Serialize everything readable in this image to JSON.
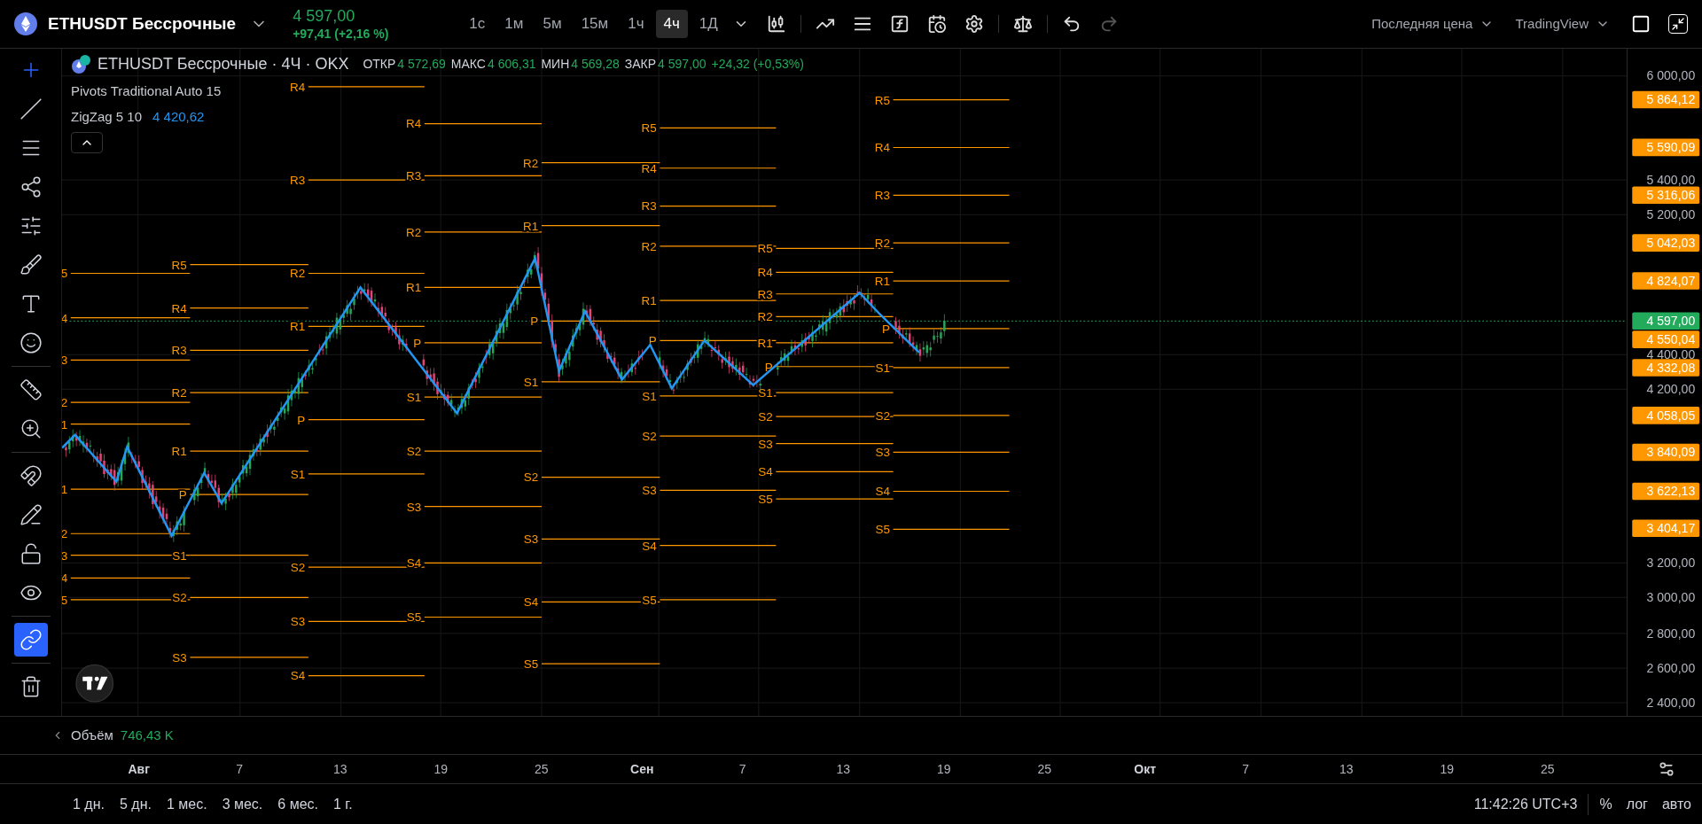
{
  "header": {
    "symbol": "ETHUSDT Бессрочные",
    "price": "4 597,00",
    "change": "+97,41 (+2,16 %)",
    "intervals": [
      {
        "label": "1с",
        "selected": false
      },
      {
        "label": "1м",
        "selected": false
      },
      {
        "label": "5м",
        "selected": false
      },
      {
        "label": "15м",
        "selected": false
      },
      {
        "label": "1ч",
        "selected": false
      },
      {
        "label": "4ч",
        "selected": true
      },
      {
        "label": "1Д",
        "selected": false
      }
    ],
    "price_source": "Последняя цена",
    "brand": "TradingView"
  },
  "left_toolbar": {
    "tools": [
      {
        "selected": false
      },
      {
        "selected": false
      },
      {
        "selected": false
      },
      {
        "selected": false
      },
      {
        "selected": false
      },
      {
        "selected": false
      },
      {
        "selected": false
      },
      {
        "selected": false
      },
      {
        "selected": false
      },
      {
        "selected": false
      },
      {
        "selected": false
      },
      {
        "selected": false
      },
      {
        "selected": false
      },
      {
        "selected": false
      },
      {
        "selected": true
      },
      {
        "selected": false
      }
    ]
  },
  "legend": {
    "symbol": "ETHUSDT Бессрочные · 4Ч · OKX",
    "ohlc": [
      {
        "label": "ОТКР",
        "value": "4 572,69"
      },
      {
        "label": "МАКС",
        "value": "4 606,31"
      },
      {
        "label": "МИН",
        "value": "4 569,28"
      },
      {
        "label": "ЗАКР",
        "value": "4 597,00"
      }
    ],
    "change": "+24,32 (+0,53%)",
    "indicators": [
      {
        "name": "Pivots Traditional Auto 15"
      },
      {
        "name": "ZigZag 5 10",
        "value": "4 420,62"
      }
    ]
  },
  "chart": {
    "pivot_groups": [
      {
        "labels": [
          "5",
          "4",
          "3",
          "2",
          "1",
          "1",
          "2",
          "3",
          "4",
          "5"
        ]
      },
      {
        "labels": [
          "R5",
          "R4",
          "R3",
          "R2",
          "R1",
          "P",
          "S1",
          "S2",
          "S3"
        ]
      },
      {
        "labels": [
          "R4",
          "R3",
          "R2",
          "R1",
          "P",
          "S1",
          "S2",
          "S3",
          "S4"
        ]
      },
      {
        "labels": [
          "R4",
          "R3",
          "R2",
          "R1",
          "P",
          "S1",
          "S2",
          "S3",
          "S4",
          "S5"
        ]
      },
      {
        "labels": [
          "R2",
          "R1",
          "P",
          "S1",
          "S2",
          "S3",
          "S4",
          "S5"
        ]
      },
      {
        "labels": [
          "R5",
          "R4",
          "R3",
          "R2",
          "R1",
          "P",
          "S1",
          "S2",
          "S3",
          "S4",
          "S5"
        ]
      },
      {
        "labels": [
          "R5",
          "R4",
          "R3",
          "R2",
          "R1",
          "P",
          "S1",
          "S2",
          "S3",
          "S4",
          "S5"
        ]
      },
      {
        "labels": [
          "R5",
          "R4",
          "R3",
          "R2",
          "R1",
          "P",
          "S1",
          "S2",
          "S3",
          "S4",
          "S5"
        ]
      }
    ]
  },
  "price_axis": {
    "ticks": [
      "6 000,00",
      "5 400,00",
      "5 200,00",
      "4 400,00",
      "4 200,00",
      "3 200,00",
      "3 000,00",
      "2 800,00",
      "2 600,00",
      "2 400,00"
    ],
    "levels": [
      "5 864,12",
      "5 590,09",
      "5 316,06",
      "5 042,03",
      "4 824,07",
      "4 550,04",
      "4 332,08",
      "4 058,05",
      "3 840,09",
      "3 622,13",
      "3 404,17"
    ],
    "last_price": "4 597,00"
  },
  "volume": {
    "label": "Объём",
    "value": "746,43 K"
  },
  "time_axis": {
    "ticks": [
      {
        "label": "Авг",
        "kind": "month"
      },
      {
        "label": "7",
        "kind": "day"
      },
      {
        "label": "13",
        "kind": "day"
      },
      {
        "label": "19",
        "kind": "day"
      },
      {
        "label": "25",
        "kind": "day"
      },
      {
        "label": "Сен",
        "kind": "month"
      },
      {
        "label": "7",
        "kind": "day"
      },
      {
        "label": "13",
        "kind": "day"
      },
      {
        "label": "19",
        "kind": "day"
      },
      {
        "label": "25",
        "kind": "day"
      },
      {
        "label": "Окт",
        "kind": "month"
      },
      {
        "label": "7",
        "kind": "day"
      },
      {
        "label": "13",
        "kind": "day"
      },
      {
        "label": "19",
        "kind": "day"
      },
      {
        "label": "25",
        "kind": "day"
      }
    ]
  },
  "bottom_bar": {
    "ranges": [
      "1 дн.",
      "5 дн.",
      "1 мес.",
      "3 мес.",
      "6 мес.",
      "1 г."
    ],
    "clock": "11:42:26 UTC+3",
    "options": [
      "%",
      "лог",
      "авто"
    ]
  }
}
